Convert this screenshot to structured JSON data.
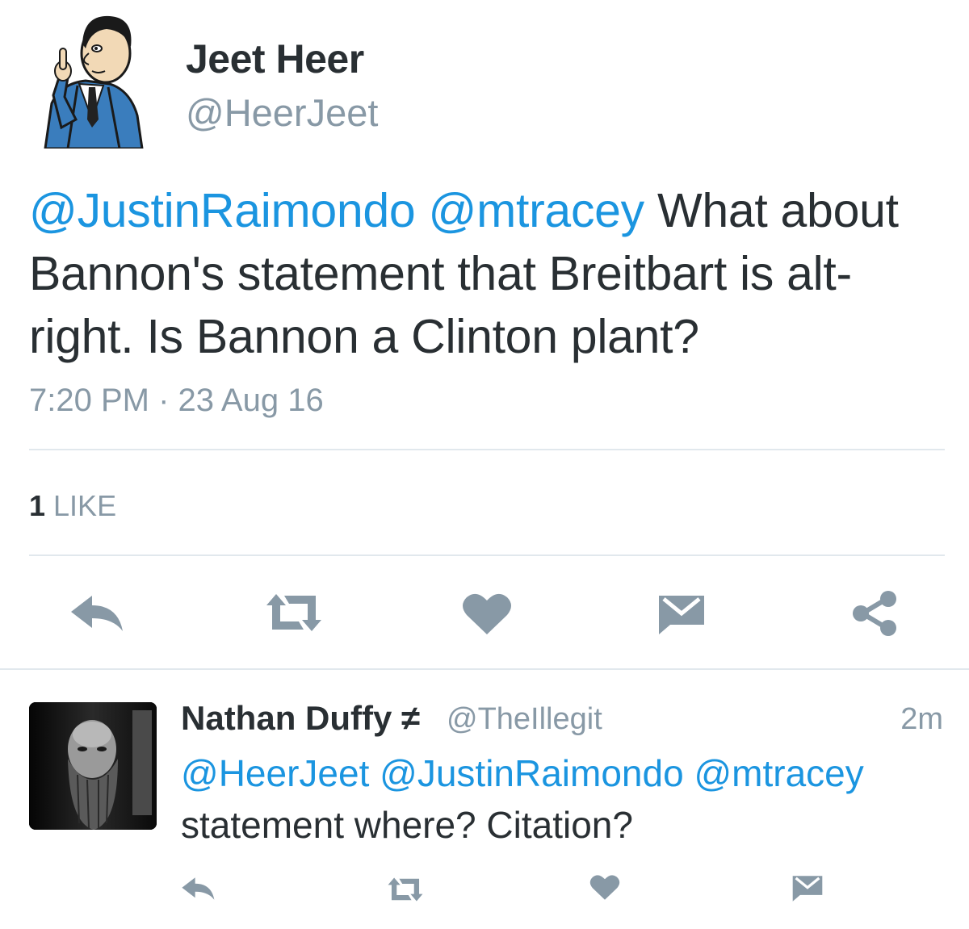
{
  "main_tweet": {
    "author": {
      "name": "Jeet Heer",
      "handle": "@HeerJeet"
    },
    "text": {
      "mention_1": "@JustinRaimondo",
      "mention_2": "@mtracey",
      "line_1_rest": " What about",
      "line_2": "Bannon's statement that Breitbart is alt-",
      "line_3": "right. Is Bannon a Clinton plant?"
    },
    "timestamp": "7:20 PM · 23 Aug 16",
    "likes": {
      "count": "1",
      "label": "LIKE"
    },
    "actions": [
      "reply-icon",
      "retweet-icon",
      "heart-icon",
      "dm-icon",
      "share-icon"
    ]
  },
  "reply_tweet": {
    "author": {
      "name": "Nathan Duffy ≠",
      "handle": "@TheIllegit"
    },
    "time": "2m",
    "text": {
      "mention_1": "@HeerJeet",
      "mention_2": "@JustinRaimondo",
      "mention_3": "@mtracey",
      "line_2": "statement where? Citation?"
    },
    "actions": [
      "reply-icon",
      "retweet-icon",
      "heart-icon",
      "dm-icon"
    ]
  },
  "colors": {
    "link": "#1b95e0",
    "secondary_text": "#8899a6",
    "icon": "#8899a6",
    "divider": "#e1e8ed",
    "primary_text": "#292f33"
  }
}
